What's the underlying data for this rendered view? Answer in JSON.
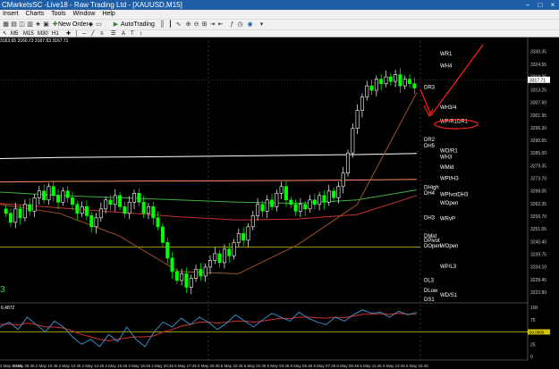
{
  "window": {
    "title": "CMarketsSC -Live18 - Raw Trading Ltd - [XAUUSD,M15]",
    "controls": [
      "–",
      "□",
      "×"
    ]
  },
  "menu": [
    "Insert",
    "Charts",
    "Tools",
    "Window",
    "Help"
  ],
  "toolbar": {
    "new_order": "New Order",
    "autotrading": "AutoTrading"
  },
  "toolbar2": {
    "timeframes": [
      "M5",
      "M15",
      "M30",
      "H1"
    ]
  },
  "ohlc_line": "3163.65 3160.73 3167.63 3167.71",
  "colors": {
    "background": "#000000",
    "up_candle": "#ffffff",
    "down_candle": "#00ff00",
    "annotation": "#ff2020",
    "bid_line": "#ffffff"
  },
  "chart_data": {
    "type": "candlestick",
    "symbol": "XAUUSD",
    "timeframe": "M15",
    "price_axis": {
      "min": 3218,
      "max": 3335,
      "ticks": [
        "3330.35",
        "3324.55",
        "3319.25",
        "3313.25",
        "3307.60",
        "3301.95",
        "3296.30",
        "3290.65",
        "3285.00",
        "3279.35",
        "3273.70",
        "3268.05",
        "3262.35",
        "3256.70",
        "3251.05",
        "3245.40",
        "3239.75",
        "3234.10",
        "3228.45",
        "3222.80"
      ]
    },
    "current_price": "3317.71",
    "time_labels": [
      "2 May 06:45",
      "2 May 08:45",
      "2 May 10:45",
      "2 May 12:45",
      "2 May 14:45",
      "2 May 16:45",
      "2 May 18:45",
      "2 May 20:45",
      "5 May 17:45",
      "5 May 20:45",
      "5 May 22:45",
      "5 May 01:45",
      "5 May 03:45",
      "5 May 05:45",
      "5 May 07:45",
      "5 May 09:45",
      "5 May 11:45",
      "5 May 13:45",
      "5 May 15:45"
    ],
    "closes": [
      3258,
      3254,
      3260,
      3256,
      3262,
      3259,
      3265,
      3268,
      3264,
      3270,
      3266,
      3263,
      3268,
      3265,
      3262,
      3258,
      3261,
      3257,
      3252,
      3256,
      3260,
      3264,
      3262,
      3266,
      3261,
      3258,
      3263,
      3267,
      3263,
      3258,
      3261,
      3256,
      3252,
      3245,
      3238,
      3232,
      3228,
      3231,
      3225,
      3229,
      3233,
      3230,
      3234,
      3237,
      3240,
      3236,
      3242,
      3239,
      3245,
      3249,
      3246,
      3252,
      3257,
      3262,
      3259,
      3264,
      3261,
      3267,
      3270,
      3264,
      3262,
      3259,
      3262,
      3260,
      3264,
      3262,
      3266,
      3263,
      3268,
      3265,
      3270,
      3276,
      3285,
      3296,
      3304,
      3310,
      3315,
      3313,
      3318,
      3316,
      3319,
      3317,
      3320,
      3315,
      3318,
      3316,
      3314
    ],
    "moving_averages": [
      {
        "color": "#ffffff",
        "values": [
          3282.5,
          3283,
          3283.2,
          3283.4,
          3283.7,
          3284,
          3284.3,
          3284.8
        ]
      },
      {
        "color": "#ff8c5a",
        "values": [
          3272,
          3272.3,
          3272.4,
          3272.5,
          3272.6,
          3272.7,
          3272.9,
          3273.2
        ]
      },
      {
        "color": "#3cb043",
        "values": [
          3267.5,
          3266,
          3265,
          3264,
          3263,
          3262.5,
          3264,
          3268.5
        ]
      },
      {
        "color": "#c83232",
        "values": [
          3262.5,
          3260.5,
          3258.5,
          3256.5,
          3255,
          3255.5,
          3257.5,
          3266
        ]
      },
      {
        "color": "#a0522d",
        "values": [
          3262,
          3258,
          3248,
          3232,
          3231,
          3244,
          3262,
          3312
        ]
      }
    ],
    "horizontal_line": {
      "price": 3243,
      "color": "#d4c400"
    },
    "level_labels": [
      {
        "text": "WR1",
        "price": 3329.5,
        "col": 2
      },
      {
        "text": "WH4",
        "price": 3324,
        "col": 2
      },
      {
        "text": "DR3",
        "price": 3314.5,
        "col": 1
      },
      {
        "text": "WH3/4",
        "price": 3305.5,
        "col": 2
      },
      {
        "text": "WP/R1DR1",
        "price": 3299.2,
        "col": 2
      },
      {
        "text": "DR2",
        "price": 3291,
        "col": 1
      },
      {
        "text": "DH5",
        "price": 3288.3,
        "col": 1
      },
      {
        "text": "WO/R1",
        "price": 3286,
        "col": 2
      },
      {
        "text": "WH3",
        "price": 3283.3,
        "col": 2
      },
      {
        "text": "WMid",
        "price": 3278.7,
        "col": 2
      },
      {
        "text": "WPI/H3",
        "price": 3273.7,
        "col": 2
      },
      {
        "text": "DHigh",
        "price": 3269.8,
        "col": 1
      },
      {
        "text": "DH4",
        "price": 3267.1,
        "col": 1
      },
      {
        "text": "WPIvotDH3",
        "price": 3266.5,
        "col": 2
      },
      {
        "text": "WOpen",
        "price": 3262.8,
        "col": 2
      },
      {
        "text": "DH3",
        "price": 3256.2,
        "col": 1
      },
      {
        "text": "WRvP",
        "price": 3255.8,
        "col": 2
      },
      {
        "text": "DMid",
        "price": 3248,
        "col": 1
      },
      {
        "text": "DPivot",
        "price": 3246,
        "col": 1
      },
      {
        "text": "DOpen",
        "price": 3243.5,
        "col": 1
      },
      {
        "text": "WOpen",
        "price": 3243.5,
        "col": 2
      },
      {
        "text": "WP/L3",
        "price": 3234.4,
        "col": 2
      },
      {
        "text": "DL3",
        "price": 3228.2,
        "col": 1
      },
      {
        "text": "DLow",
        "price": 3223.5,
        "col": 1
      },
      {
        "text": "WD/S1",
        "price": 3221.6,
        "col": 2
      },
      {
        "text": "DS1",
        "price": 3219.5,
        "col": 1
      }
    ],
    "corner_label": "3",
    "oscillator": {
      "label": "6.4872",
      "ylim": [
        0,
        100
      ],
      "ticks": [
        "100",
        "75",
        "25",
        "0"
      ],
      "level_value": "50.0000",
      "level": 50,
      "main": [
        60,
        70,
        55,
        80,
        65,
        50,
        72,
        60,
        40,
        25,
        35,
        20,
        45,
        30,
        60,
        35,
        20,
        50,
        70,
        60,
        78,
        65,
        80,
        70,
        55,
        68,
        85,
        72,
        60,
        75,
        88,
        80,
        72,
        90,
        78,
        70,
        65,
        80,
        72,
        85,
        95,
        88,
        90,
        80,
        92,
        85,
        90
      ],
      "signal": [
        65,
        66,
        64,
        68,
        65,
        60,
        60,
        58,
        52,
        45,
        40,
        35,
        32,
        35,
        38,
        40,
        40,
        42,
        50,
        55,
        62,
        65,
        70,
        70,
        68,
        70,
        72,
        72,
        70,
        72,
        75,
        78,
        77,
        80,
        80,
        79,
        78,
        80,
        79,
        82,
        86,
        86,
        87,
        86,
        88,
        86,
        86
      ]
    }
  }
}
